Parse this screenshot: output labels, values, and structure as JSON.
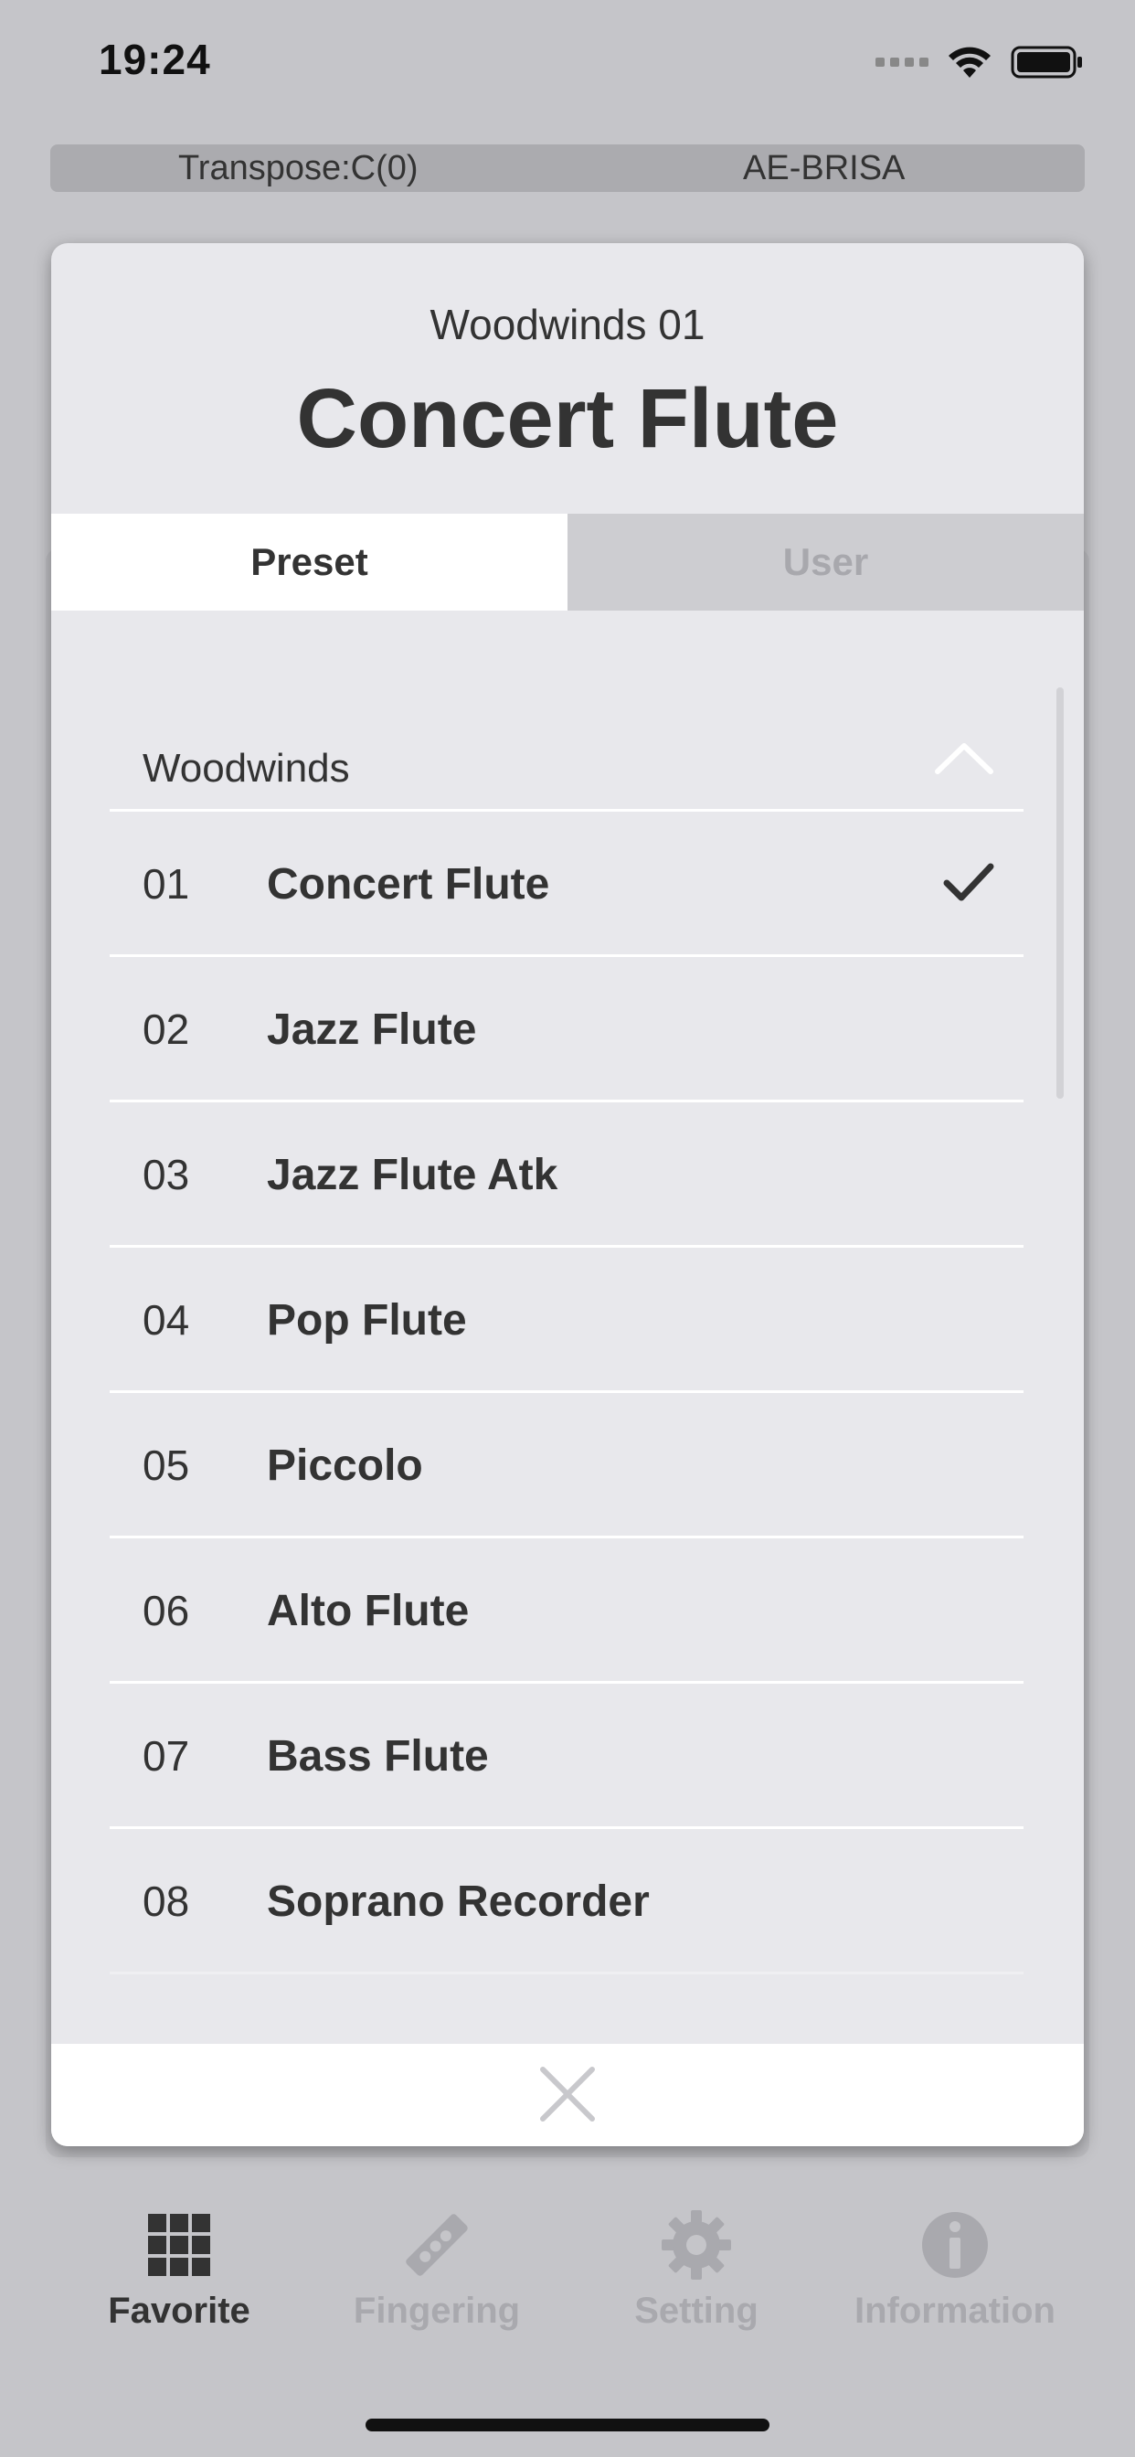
{
  "status_bar": {
    "time": "19:24"
  },
  "info_bar": {
    "transpose": "Transpose:C(0)",
    "device": "AE-BRISA"
  },
  "dialog": {
    "subtitle": "Woodwinds 01",
    "title": "Concert Flute",
    "tabs": [
      {
        "label": "Preset",
        "selected": true
      },
      {
        "label": "User",
        "selected": false
      }
    ],
    "group": {
      "label": "Woodwinds",
      "expanded": true
    },
    "items": [
      {
        "number": "01",
        "name": "Concert Flute",
        "selected": true
      },
      {
        "number": "02",
        "name": "Jazz Flute",
        "selected": false
      },
      {
        "number": "03",
        "name": "Jazz Flute Atk",
        "selected": false
      },
      {
        "number": "04",
        "name": "Pop Flute",
        "selected": false
      },
      {
        "number": "05",
        "name": "Piccolo",
        "selected": false
      },
      {
        "number": "06",
        "name": "Alto Flute",
        "selected": false
      },
      {
        "number": "07",
        "name": "Bass Flute",
        "selected": false
      },
      {
        "number": "08",
        "name": "Soprano Recorder",
        "selected": false
      }
    ]
  },
  "tab_bar": {
    "items": [
      {
        "label": "Favorite",
        "icon": "grid-icon",
        "active": true
      },
      {
        "label": "Fingering",
        "icon": "fingering-icon",
        "active": false
      },
      {
        "label": "Setting",
        "icon": "gear-icon",
        "active": false
      },
      {
        "label": "Information",
        "icon": "info-icon",
        "active": false
      }
    ]
  },
  "colors": {
    "background": "#c5c5c9",
    "dialog": "#e8e8ec",
    "text": "#333333",
    "inactive": "#a9a9ae"
  }
}
